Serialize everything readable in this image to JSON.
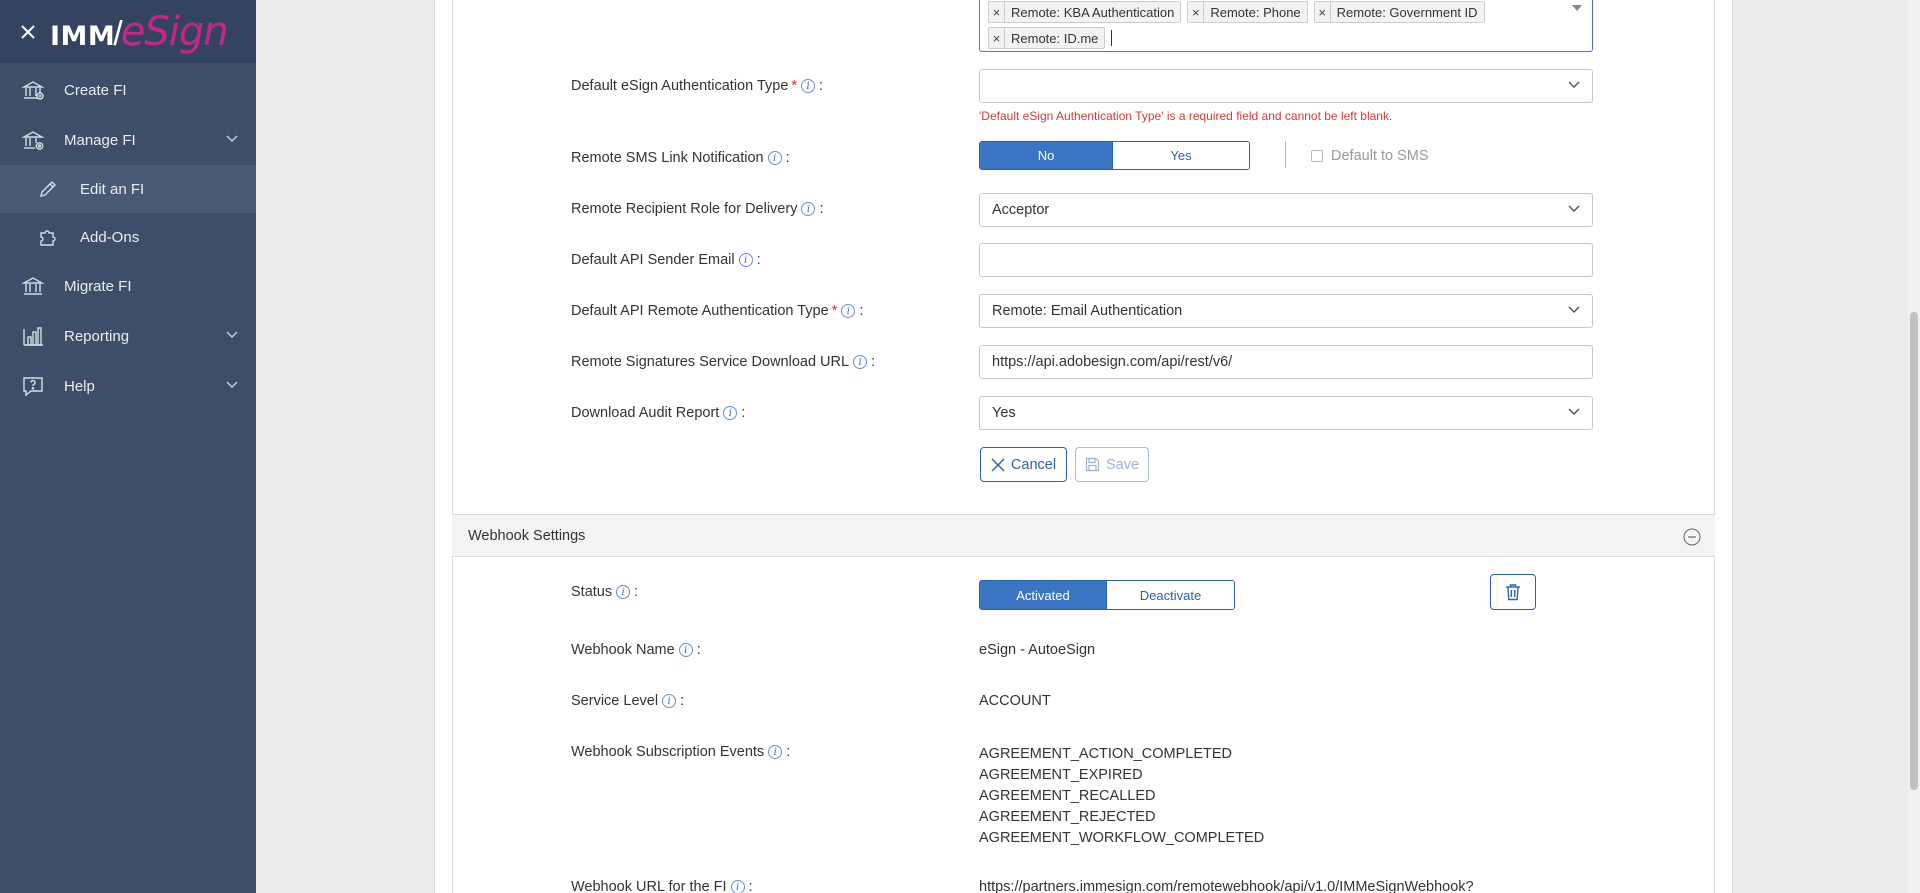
{
  "sidebar": {
    "logo": {
      "imm": "IMM",
      "slash": "/",
      "esign": "eSign"
    },
    "items": {
      "create_fi": "Create FI",
      "manage_fi": "Manage FI",
      "edit_fi": "Edit an FI",
      "add_ons": "Add-Ons",
      "migrate_fi": "Migrate FI",
      "reporting": "Reporting",
      "help": "Help"
    }
  },
  "form": {
    "auth_types_chips": [
      "Remote: KBA Authentication",
      "Remote: Phone",
      "Remote: Government ID",
      "Remote: ID.me"
    ],
    "default_esign_auth": {
      "label": "Default eSign Authentication Type",
      "value": "",
      "error": "'Default eSign Authentication Type' is a required field and cannot be left blank."
    },
    "sms_notification": {
      "label": "Remote SMS Link Notification",
      "options": [
        "No",
        "Yes"
      ],
      "selected": "No",
      "default_sms_label": "Default to SMS"
    },
    "recipient_role": {
      "label": "Remote Recipient Role for Delivery",
      "value": "Acceptor"
    },
    "api_sender_email": {
      "label": "Default API Sender Email",
      "value": ""
    },
    "api_remote_auth": {
      "label": "Default API Remote Authentication Type",
      "value": "Remote: Email Authentication"
    },
    "download_url": {
      "label": "Remote Signatures Service Download URL",
      "value": "https://api.adobesign.com/api/rest/v6/"
    },
    "audit_report": {
      "label": "Download Audit Report",
      "value": "Yes"
    },
    "cancel_label": "Cancel",
    "save_label": "Save"
  },
  "webhook": {
    "section_title": "Webhook Settings",
    "status": {
      "label": "Status",
      "options": [
        "Activated",
        "Deactivate"
      ],
      "selected": "Activated"
    },
    "name": {
      "label": "Webhook Name",
      "value": "eSign - AutoeSign"
    },
    "service_level": {
      "label": "Service Level",
      "value": "ACCOUNT"
    },
    "events": {
      "label": "Webhook Subscription Events",
      "values": [
        "AGREEMENT_ACTION_COMPLETED",
        "AGREEMENT_EXPIRED",
        "AGREEMENT_RECALLED",
        "AGREEMENT_REJECTED",
        "AGREEMENT_WORKFLOW_COMPLETED"
      ]
    },
    "url": {
      "label": "Webhook URL for the FI",
      "value": "https://partners.immesign.com/remotewebhook/api/v1.0/IMMeSignWebhook?"
    }
  },
  "colors": {
    "sidebar": "#3e4e68",
    "accent": "#3c74c4",
    "error": "#d03b3b",
    "brand_pink": "#c2278c"
  }
}
